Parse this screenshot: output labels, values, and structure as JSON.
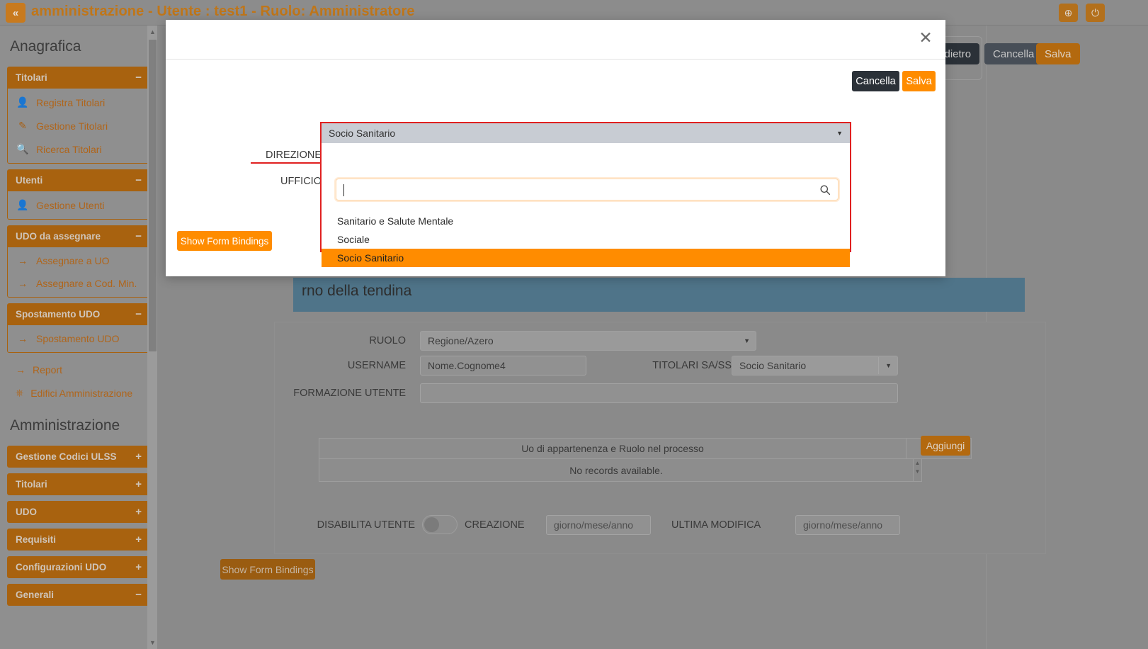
{
  "topbar": {
    "collapse_icon": "«",
    "title": "amministrazione - Utente : test1 - Ruolo: Amministratore",
    "globe_icon": "⊕",
    "power_icon": "⏻"
  },
  "sidebar": {
    "heading_1": "Anagrafica",
    "heading_2": "Amministrazione",
    "groups": [
      {
        "label": "Titolari",
        "sign": "−",
        "open": true,
        "items": [
          {
            "label": "Registra Titolari",
            "icon": "user-plus-icon",
            "glyph": "👤"
          },
          {
            "label": "Gestione Titolari",
            "icon": "edit-icon",
            "glyph": "✎"
          },
          {
            "label": "Ricerca Titolari",
            "icon": "search-icon",
            "glyph": "🔍"
          }
        ]
      },
      {
        "label": "Utenti",
        "sign": "−",
        "open": true,
        "items": [
          {
            "label": "Gestione Utenti",
            "icon": "user-edit-icon",
            "glyph": "👤"
          }
        ]
      },
      {
        "label": "UDO da assegnare",
        "sign": "−",
        "open": true,
        "items": [
          {
            "label": "Assegnare a UO",
            "icon": "arrow-right-icon",
            "glyph": "→"
          },
          {
            "label": "Assegnare a Cod. Min.",
            "icon": "arrow-right-icon",
            "glyph": "→"
          }
        ]
      },
      {
        "label": "Spostamento UDO",
        "sign": "−",
        "open": true,
        "items": [
          {
            "label": "Spostamento UDO",
            "icon": "arrow-right-icon",
            "glyph": "→"
          }
        ]
      }
    ],
    "loose_items": [
      {
        "label": "Report",
        "icon": "arrow-right-icon",
        "glyph": "→"
      },
      {
        "label": "Edifici Amministrazione",
        "icon": "building-icon",
        "glyph": "⌸"
      }
    ],
    "collapsed_groups": [
      {
        "label": "Gestione Codici ULSS",
        "sign": "+"
      },
      {
        "label": "Titolari",
        "sign": "+"
      },
      {
        "label": "UDO",
        "sign": "+"
      },
      {
        "label": "Requisiti",
        "sign": "+"
      },
      {
        "label": "Configurazioni UDO",
        "sign": "+"
      },
      {
        "label": "Generali",
        "sign": "−"
      }
    ],
    "scroll_up_icon": "▲",
    "scroll_down_icon": "▼"
  },
  "main": {
    "toolbar": {
      "indietro_label": "Indietro",
      "cancella_label": "Cancella",
      "salva_label": "Salva"
    },
    "info_banner": "rno della tendina",
    "show_form_bindings_label": "Show Form Bindings",
    "form": {
      "ruolo_label": "RUOLO",
      "ruolo_value": "Regione/Azero",
      "username_label": "USERNAME",
      "username_value": "Nome.Cognome4",
      "titolari_label": "TITOLARI SA/SS",
      "titolari_value": "Socio Sanitario",
      "formazione_label": "FORMAZIONE UTENTE",
      "formazione_value": "",
      "table_header": "Uo di appartenenza e Ruolo nel processo",
      "table_empty": "No records available.",
      "aggiungi_label": "Aggiungi",
      "disabilita_label": "DISABILITA UTENTE",
      "creazione_label": "CREAZIONE",
      "creazione_placeholder": "giorno/mese/anno",
      "ultima_modifica_label": "ULTIMA MODIFICA",
      "ultima_modifica_placeholder": "giorno/mese/anno",
      "caret_icon": "▼",
      "scroll_up_icon": "▲",
      "scroll_down_icon": "▼"
    }
  },
  "modal": {
    "close_icon": "✕",
    "cancella_label": "Cancella",
    "salva_label": "Salva",
    "show_form_bindings_label": "Show Form Bindings",
    "direzione_label": "DIREZIONE",
    "ufficio_label": "UFFICIO",
    "dropdown": {
      "selected_value": "Socio Sanitario",
      "caret_icon": "▼",
      "search_value": "",
      "search_icon": "search-icon",
      "options": [
        {
          "label": "Sanitario e Salute Mentale",
          "selected": false
        },
        {
          "label": "Sociale",
          "selected": false
        },
        {
          "label": "Socio Sanitario",
          "selected": true
        }
      ]
    }
  },
  "colors": {
    "brand_orange": "#b3690f",
    "accent_orange": "#ff8c00",
    "validation_red": "#e02020",
    "banner_blue": "#4f7489",
    "dark_button": "#2b3138"
  }
}
